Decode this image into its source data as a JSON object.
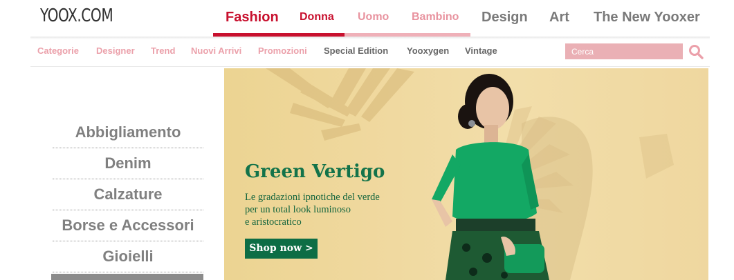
{
  "brand": {
    "logo": "YOOX.COM"
  },
  "top_nav": {
    "fashion": "Fashion",
    "donna": "Donna",
    "uomo": "Uomo",
    "bambino": "Bambino",
    "design": "Design",
    "art": "Art",
    "new_yooxer": "The New Yooxer",
    "active": "Fashion",
    "active_sub": "Donna"
  },
  "sub_nav": {
    "items": [
      "Categorie",
      "Designer",
      "Trend",
      "Nuovi Arrivi",
      "Promozioni",
      "Special Edition",
      "Yooxygen",
      "Vintage"
    ]
  },
  "search": {
    "placeholder": "Cerca",
    "icon": "search-icon"
  },
  "categories": {
    "items": [
      "Abbigliamento",
      "Denim",
      "Calzature",
      "Borse e Accessori",
      "Gioielli"
    ]
  },
  "hero": {
    "title": "Green Vertigo",
    "text_lines": [
      "Le gradazioni ipnotiche del verde",
      "per un total look luminoso",
      "e aristocratico"
    ],
    "cta": "Shop now >"
  },
  "colors": {
    "brand_red": "#c8102e",
    "pink": "#eba0aa",
    "gray_text": "#808080",
    "hero_green": "#13734a",
    "hero_bg": "#f0d9a0"
  }
}
